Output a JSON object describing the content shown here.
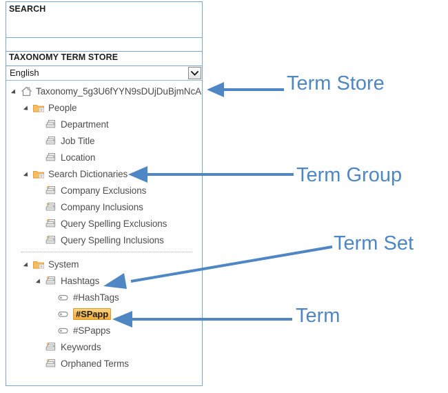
{
  "panel": {
    "search": {
      "title": "SEARCH",
      "input_value": "",
      "placeholder": ""
    },
    "term_store": {
      "title": "TAXONOMY TERM STORE"
    },
    "language_select": {
      "value": "English",
      "icon": "chevron-down-icon"
    }
  },
  "tree": [
    {
      "id": "taxonomy-store",
      "label": "Taxonomy_5g3U6fYYN9sDUjDuBjmNcA",
      "icon": "home-icon",
      "level": 0,
      "twisty": "open",
      "highlight": false
    },
    {
      "id": "people",
      "label": "People",
      "icon": "folder-group-icon",
      "level": 1,
      "twisty": "open",
      "highlight": false
    },
    {
      "id": "department",
      "label": "Department",
      "icon": "termset-icon",
      "level": 2,
      "twisty": "none",
      "highlight": false
    },
    {
      "id": "job-title",
      "label": "Job Title",
      "icon": "termset-icon",
      "level": 2,
      "twisty": "none",
      "highlight": false
    },
    {
      "id": "location",
      "label": "Location",
      "icon": "termset-icon",
      "level": 2,
      "twisty": "none",
      "highlight": false
    },
    {
      "id": "search-dictionaries",
      "label": "Search Dictionaries",
      "icon": "folder-group-icon",
      "level": 1,
      "twisty": "open",
      "highlight": false
    },
    {
      "id": "company-exclusions",
      "label": "Company Exclusions",
      "icon": "termset-system-icon",
      "level": 2,
      "twisty": "none",
      "highlight": false
    },
    {
      "id": "company-inclusions",
      "label": "Company Inclusions",
      "icon": "termset-system-icon",
      "level": 2,
      "twisty": "none",
      "highlight": false
    },
    {
      "id": "query-spelling-exclusions",
      "label": "Query Spelling Exclusions",
      "icon": "termset-system-icon",
      "level": 2,
      "twisty": "none",
      "highlight": false
    },
    {
      "id": "query-spelling-inclusions",
      "label": "Query Spelling Inclusions",
      "icon": "termset-system-icon",
      "level": 2,
      "twisty": "none",
      "highlight": false
    },
    {
      "id": "separator",
      "label": "",
      "icon": "separator",
      "level": 0,
      "twisty": "none",
      "highlight": false
    },
    {
      "id": "system",
      "label": "System",
      "icon": "folder-group-icon",
      "level": 1,
      "twisty": "open",
      "highlight": false
    },
    {
      "id": "hashtags",
      "label": "Hashtags",
      "icon": "termset-system-icon",
      "level": 2,
      "twisty": "open",
      "highlight": false
    },
    {
      "id": "hashtags-term",
      "label": "#HashTags",
      "icon": "term-tag-icon",
      "level": 3,
      "twisty": "none",
      "highlight": false
    },
    {
      "id": "spapp-term",
      "label": "#SPapp",
      "icon": "term-tag-icon",
      "level": 3,
      "twisty": "none",
      "highlight": true
    },
    {
      "id": "spapps-term",
      "label": "#SPapps",
      "icon": "term-tag-icon",
      "level": 3,
      "twisty": "none",
      "highlight": false
    },
    {
      "id": "keywords",
      "label": "Keywords",
      "icon": "termset-system-icon",
      "level": 2,
      "twisty": "none",
      "highlight": false
    },
    {
      "id": "orphaned-terms",
      "label": "Orphaned Terms",
      "icon": "termset-system-icon",
      "level": 2,
      "twisty": "none",
      "highlight": false
    }
  ],
  "annotations": [
    {
      "id": "term-store",
      "label": "Term Store"
    },
    {
      "id": "term-group",
      "label": "Term Group"
    },
    {
      "id": "term-set",
      "label": "Term Set"
    },
    {
      "id": "term",
      "label": "Term"
    }
  ],
  "colors": {
    "panel_border": "#7aa6d2",
    "annotation_blue": "#4f87c4",
    "highlight_orange": "#f3ac3c",
    "folder_yellow": "#f6b74d",
    "tree_text": "#4e4e4e"
  }
}
